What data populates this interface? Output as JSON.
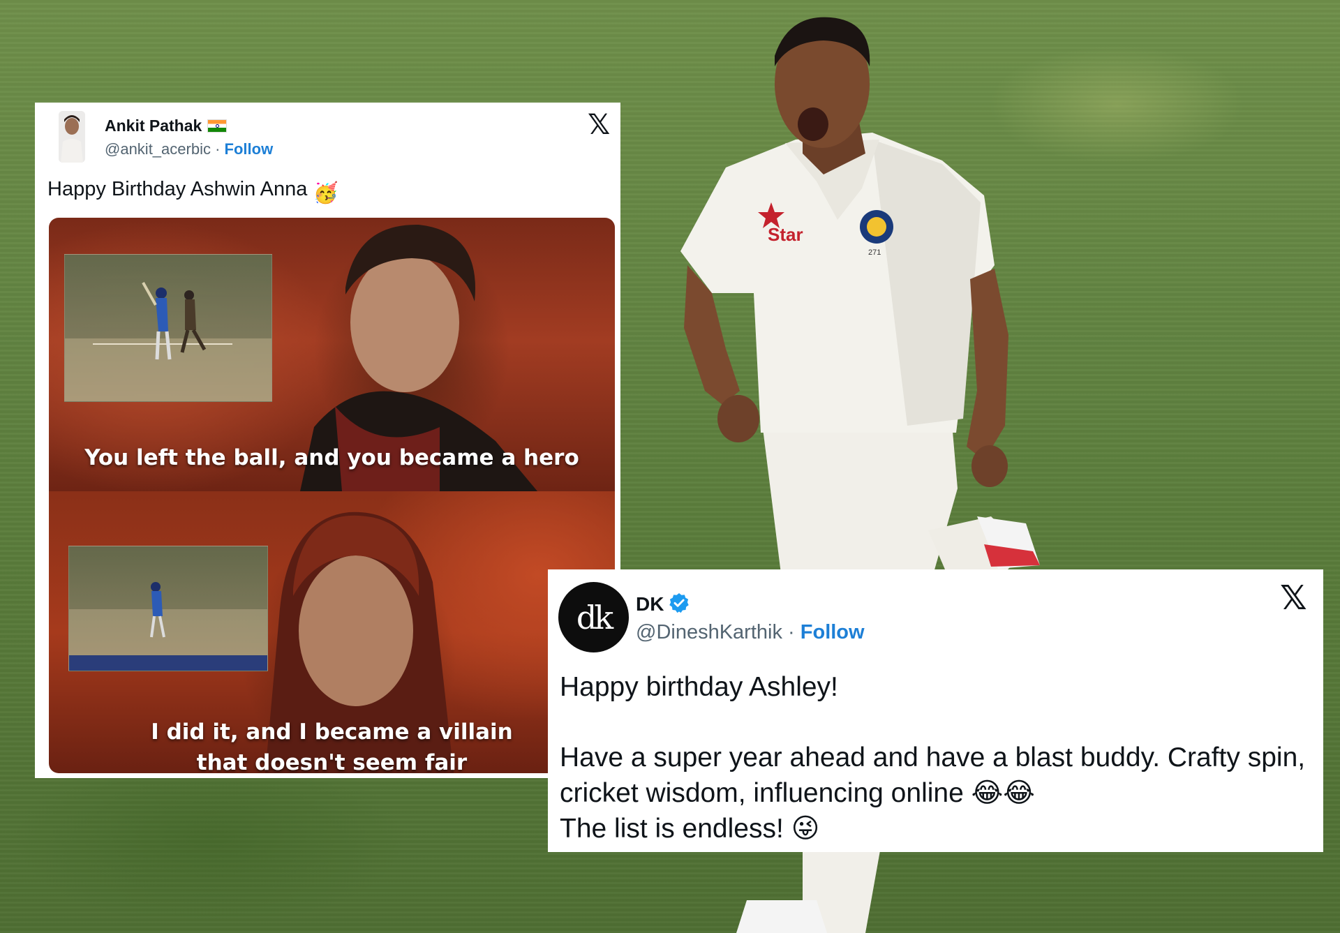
{
  "background": {
    "scene": "cricket-bowler-celebration",
    "jersey_logo": "Star",
    "jersey_number": "271"
  },
  "tweets": [
    {
      "name": "Ankit Pathak",
      "flag_icon": "india-flag-icon",
      "handle": "@ankit_acerbic",
      "separator": "·",
      "follow_label": "Follow",
      "platform_logo": "𝕏",
      "text": "Happy Birthday Ashwin Anna",
      "text_emoji": "🥳",
      "meme": {
        "caption_top": "You left the ball, and you became a hero",
        "caption_bottom_line1": "I did it, and I became a villain",
        "caption_bottom_line2": "that doesn't seem fair"
      }
    },
    {
      "name": "DK",
      "avatar_text": "dk",
      "verified_icon": "verified-badge-icon",
      "handle": "@DineshKarthik",
      "separator": "·",
      "follow_label": "Follow",
      "platform_logo": "𝕏",
      "line1": "Happy birthday Ashley!",
      "line2": "Have a super year ahead and have a blast buddy. Crafty spin, cricket wisdom, influencing online",
      "line2_emoji": "😂😂",
      "line3": "The list is endless!",
      "line3_emoji": "😜"
    }
  ],
  "colors": {
    "follow": "#1d7fd6",
    "text": "#0f1419",
    "muted": "#536471",
    "verified": "#1d9bf0"
  }
}
